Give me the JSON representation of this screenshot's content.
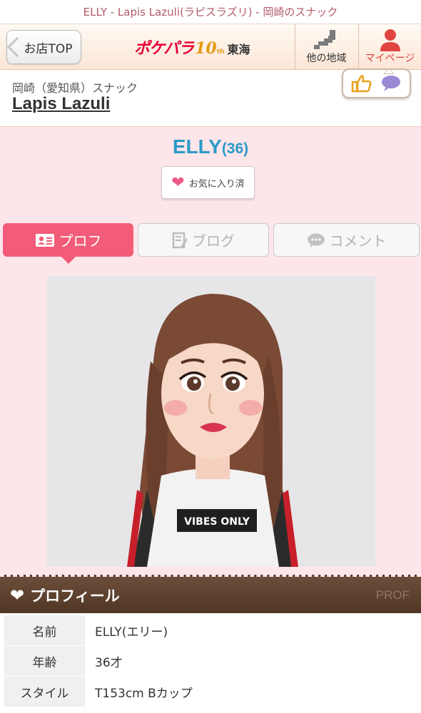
{
  "browser": {
    "title": "ELLY - Lapis Lazuli(ラピスラズリ) - 岡崎のスナック"
  },
  "header": {
    "back_label": "お店TOP",
    "logo_main": "ポケパラ",
    "logo_ten": "10",
    "logo_th": "th",
    "logo_region": "東海",
    "region_label": "他の地域",
    "mypage_label": "マイページ",
    "accent_color": "#e0453f"
  },
  "shop": {
    "category": "岡崎（愛知県）スナック",
    "name": "Lapis Lazuli"
  },
  "girl": {
    "name": "ELLY",
    "age": "(36)",
    "fav_label": "お気に入り済",
    "photo_shirt_text": "VIBES ONLY"
  },
  "tabs": [
    {
      "label": "プロフ",
      "icon": "profile-card-icon",
      "active": true
    },
    {
      "label": "ブログ",
      "icon": "blog-edit-icon",
      "active": false
    },
    {
      "label": "コメント",
      "icon": "comment-bubble-icon",
      "active": false
    }
  ],
  "profile": {
    "section_title": "プロフィール",
    "section_en": "PROF",
    "rows": [
      {
        "label": "名前",
        "value": "ELLY(エリー)"
      },
      {
        "label": "年齢",
        "value": "36才"
      },
      {
        "label": "スタイル",
        "value": "T153cm Bカップ"
      }
    ]
  }
}
